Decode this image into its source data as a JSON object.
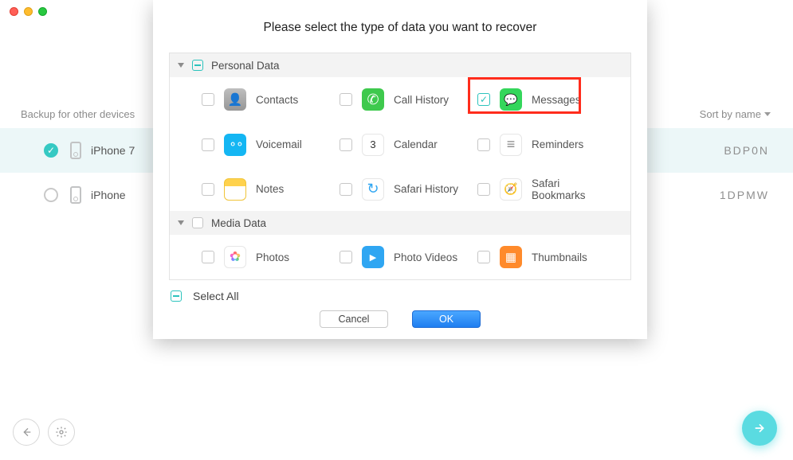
{
  "window": {
    "backup_label": "Backup for other devices",
    "sort_label": "Sort by name",
    "devices": [
      {
        "name": "iPhone 7",
        "selected": true,
        "id_tail": "BDP0N"
      },
      {
        "name": "iPhone",
        "selected": false,
        "id_tail": "1DPMW"
      }
    ]
  },
  "modal": {
    "title": "Please select the type of data you want to recover",
    "sections": [
      {
        "title": "Personal Data",
        "rows": [
          [
            {
              "label": "Contacts",
              "checked": false,
              "icon": "contacts"
            },
            {
              "label": "Call History",
              "checked": false,
              "icon": "callhistory"
            },
            {
              "label": "Messages",
              "checked": true,
              "icon": "messages",
              "highlight": true
            }
          ],
          [
            {
              "label": "Voicemail",
              "checked": false,
              "icon": "voicemail"
            },
            {
              "label": "Calendar",
              "checked": false,
              "icon": "calendar"
            },
            {
              "label": "Reminders",
              "checked": false,
              "icon": "reminders"
            }
          ],
          [
            {
              "label": "Notes",
              "checked": false,
              "icon": "notes"
            },
            {
              "label": "Safari History",
              "checked": false,
              "icon": "safarihistory"
            },
            {
              "label": "Safari Bookmarks",
              "checked": false,
              "icon": "safaribookmarks"
            }
          ]
        ]
      },
      {
        "title": "Media Data",
        "rows": [
          [
            {
              "label": "Photos",
              "checked": false,
              "icon": "photos"
            },
            {
              "label": "Photo Videos",
              "checked": false,
              "icon": "photovideos"
            },
            {
              "label": "Thumbnails",
              "checked": false,
              "icon": "thumbnails"
            }
          ]
        ]
      }
    ],
    "select_all_label": "Select All",
    "cancel_label": "Cancel",
    "ok_label": "OK"
  }
}
